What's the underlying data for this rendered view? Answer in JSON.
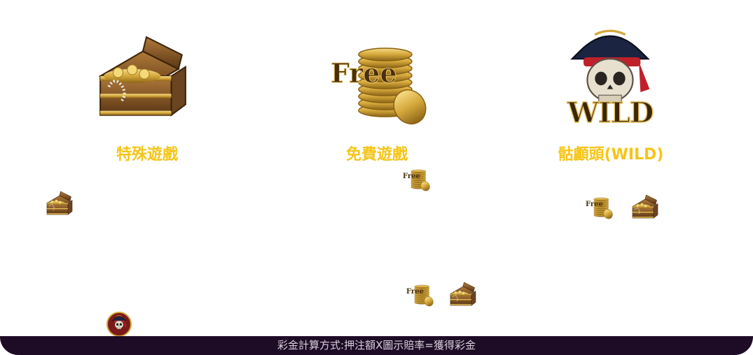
{
  "symbols": [
    {
      "title": "特殊遊戲",
      "icon": "treasure-chest-icon"
    },
    {
      "title": "免費遊戲",
      "icon": "free-coins-icon",
      "badge": "Free"
    },
    {
      "title": "骷顱頭(WILD)",
      "icon": "pirate-skull-wild-icon",
      "badge": "WILD"
    }
  ],
  "mini_badge": "Free",
  "footer": {
    "text": "彩金計算方式:押注額X圖示賠率=獲得彩金"
  },
  "colors": {
    "title": "#f5c518",
    "footer_bg": "#1e0b26",
    "footer_text": "#d8d2dc",
    "gold": "#d4a73a",
    "wood": "#8a5a2b"
  }
}
